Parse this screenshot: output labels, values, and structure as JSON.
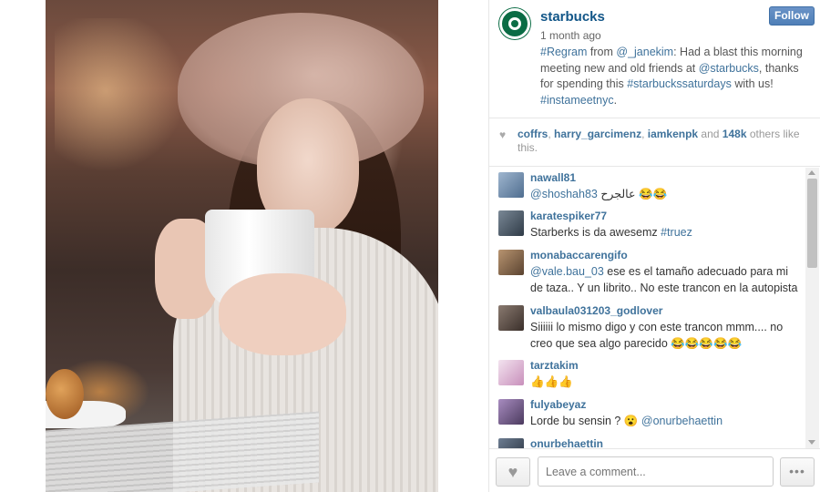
{
  "post": {
    "username": "starbucks",
    "time_ago": "1 month ago",
    "follow_label": "Follow",
    "caption": {
      "t1": "#Regram",
      "t2": " from ",
      "t3": "@_janekim",
      "t4": ": Had a blast this morning meeting new and old friends at ",
      "t5": "@starbucks",
      "t6": ", thanks for spending this ",
      "t7": "#starbuckssaturdays",
      "t8": " with us! ",
      "t9": "#instameetnyc",
      "t10": "."
    }
  },
  "likes": {
    "u1": "coffrs",
    "sep1": ", ",
    "u2": "harry_garcimenz",
    "sep2": ", ",
    "u3": "iamkenpk",
    "and": " and ",
    "count": "148k",
    "rest": " others like this."
  },
  "comments": [
    {
      "user": "nawall81",
      "text_parts": {
        "mention": "@shoshah83",
        "text": " عالجرح 😂😂"
      },
      "avatar_color": "#6f8fb0"
    },
    {
      "user": "karatespiker77",
      "text_parts": {
        "text": "Starberks is da awesemz ",
        "tag": "#truez"
      },
      "avatar_color": "#4b5a68"
    },
    {
      "user": "monabaccarengifo",
      "text_parts": {
        "mention": "@vale.bau_03",
        "text": " ese es el tamaño adecuado para mi de taza.. Y un librito.. No este trancon en la autopista"
      },
      "avatar_color": "#8a6c4e"
    },
    {
      "user": "valbaula031203_godlover",
      "text_parts": {
        "text": "Siiiiii lo mismo digo y con este trancon mmm.... no creo que sea algo parecido 😂😂😂😂😂"
      },
      "avatar_color": "#5b4e47"
    },
    {
      "user": "tarztakim",
      "text_parts": {
        "text": "👍👍👍"
      },
      "avatar_color": "#e7cde2"
    },
    {
      "user": "fulyabeyaz",
      "text_parts": {
        "text": "Lorde bu sensin ? 😮 ",
        "mention": "@onurbehaettin"
      },
      "avatar_color": "#7a5f8c"
    },
    {
      "user": "onurbehaettin",
      "text_parts": {
        "text": ""
      },
      "avatar_color": "#3d4a5c"
    }
  ],
  "comment_input": {
    "placeholder": "Leave a comment..."
  },
  "icons": {
    "heart": "heart-icon",
    "more": "more-options-icon",
    "logo": "starbucks-logo"
  },
  "colors": {
    "link": "#3f729b",
    "username": "#125688",
    "follow_button": "#5b88bf",
    "brand_green": "#0b6c45"
  }
}
